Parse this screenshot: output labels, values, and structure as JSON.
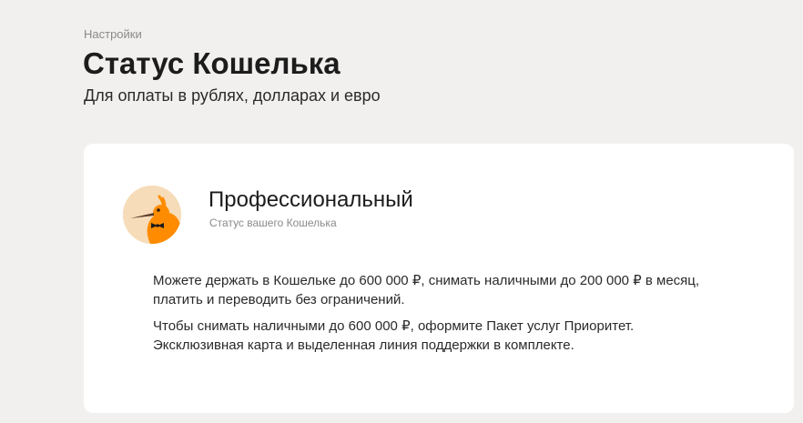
{
  "breadcrumb": "Настройки",
  "header": {
    "title": "Статус Кошелька",
    "subtitle": "Для оплаты в рублях, долларах и евро"
  },
  "status": {
    "name": "Профессиональный",
    "caption": "Статус вашего Кошелька",
    "avatar_icon": "kiwi-bird-with-bowtie-icon"
  },
  "description": {
    "paragraph_1": "Можете держать в Кошельке до 600 000 ₽, снимать наличными до 200 000 ₽ в месяц, платить и переводить без ограничений.",
    "paragraph_2": "Чтобы снимать наличными до 600 000 ₽, оформите Пакет услуг Приоритет. Эксклюзивная карта и выделенная линия поддержки в комплекте."
  },
  "colors": {
    "page_background": "#f1f0ee",
    "card_background": "#ffffff",
    "accent_orange": "#ff8c00",
    "avatar_background": "#f6dcb9"
  }
}
